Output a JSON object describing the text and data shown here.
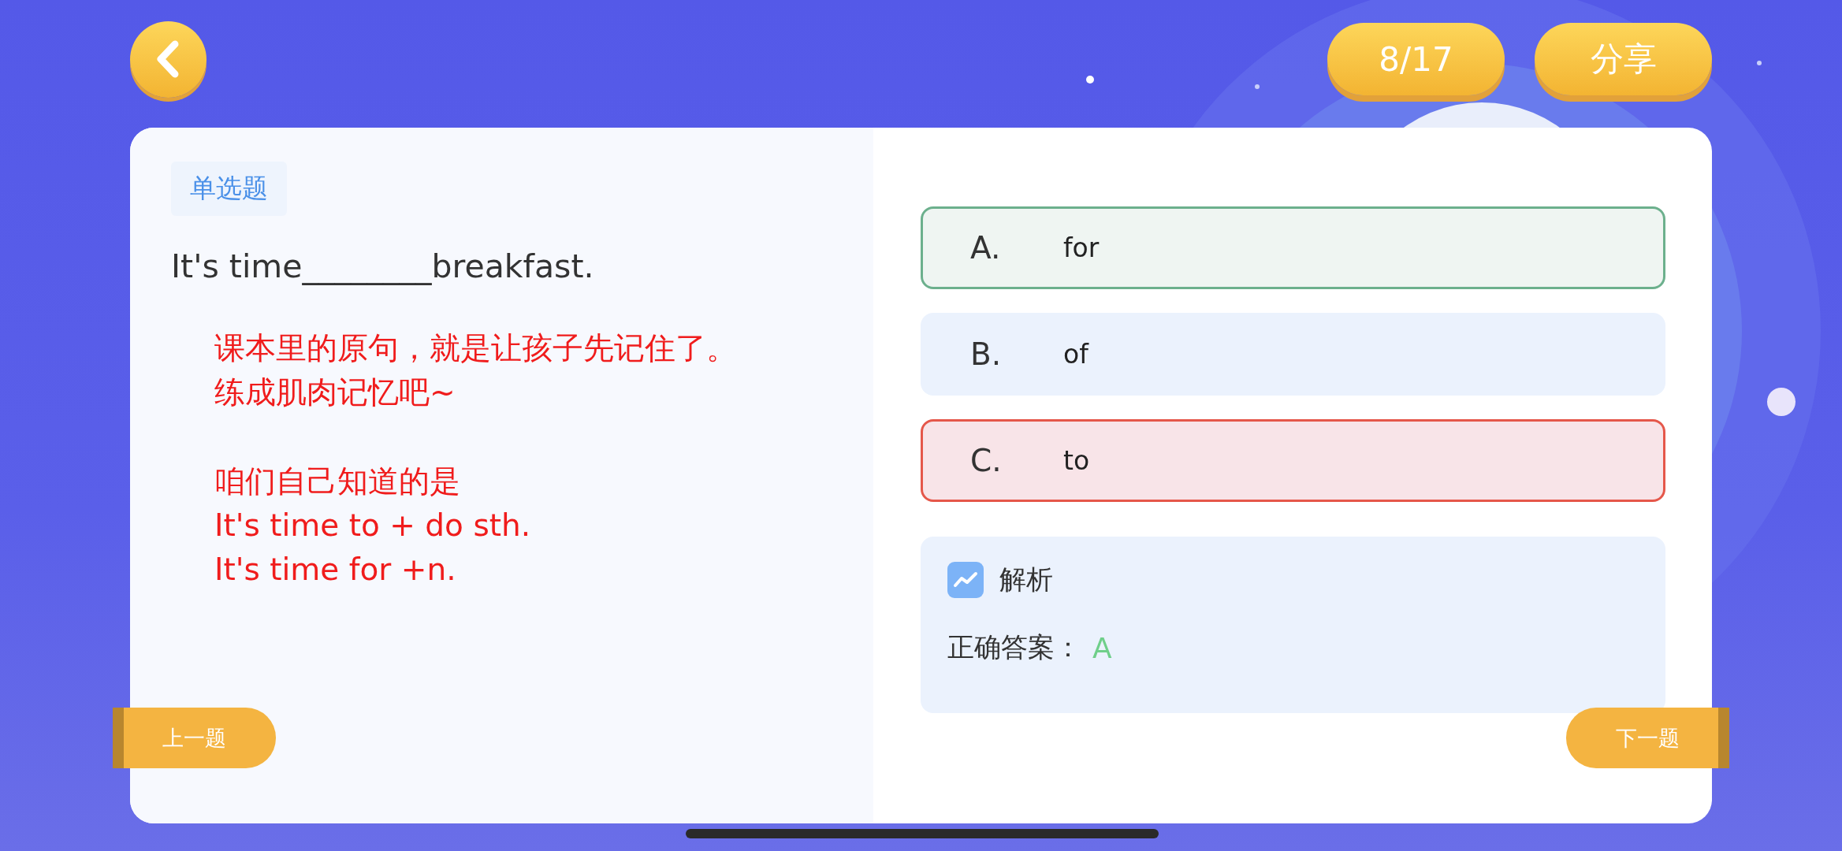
{
  "header": {
    "progress": "8/17",
    "share": "分享"
  },
  "question": {
    "type_tag": "单选题",
    "text": "It's time________breakfast.",
    "notes": [
      [
        "课本里的原句，就是让孩子先记住了。",
        "练成肌肉记忆吧~"
      ],
      [
        "咱们自己知道的是",
        "It's time to + do sth.",
        "It's time for +n."
      ]
    ]
  },
  "options": [
    {
      "letter": "A.",
      "text": "for",
      "correct": true,
      "wrong": false
    },
    {
      "letter": "B.",
      "text": "of",
      "correct": false,
      "wrong": false
    },
    {
      "letter": "C.",
      "text": "to",
      "correct": false,
      "wrong": true
    }
  ],
  "analysis": {
    "title": "解析",
    "answer_label": "正确答案：",
    "answer": "A"
  },
  "navigation": {
    "previous": "上一题",
    "next": "下一题"
  }
}
